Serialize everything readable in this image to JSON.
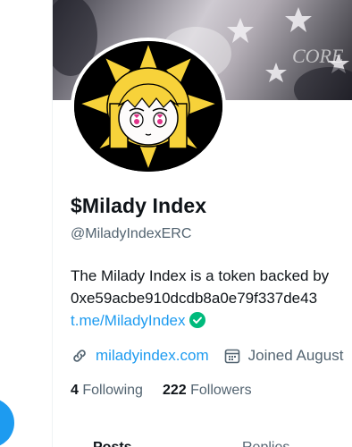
{
  "profile": {
    "display_name": "$Milady Index",
    "handle": "@MiladyIndexERC",
    "bio_line1": "The Milady Index is a token backed by",
    "bio_line2": "0xe59acbe910dcdb8a0e79f337de43",
    "bio_link": "t.me/MiladyIndex",
    "website": "miladyindex.com",
    "joined": "Joined August"
  },
  "stats": {
    "following_count": "4",
    "following_label": "Following",
    "followers_count": "222",
    "followers_label": "Followers"
  },
  "tabs": [
    {
      "label": "Posts"
    },
    {
      "label": "Replies"
    }
  ],
  "colors": {
    "accent": "#1d9bf0",
    "secondary_text": "#536471",
    "verified": "#00ba7c"
  },
  "icons": [
    "link-icon",
    "calendar-icon",
    "verified-check-icon",
    "compose-icon"
  ]
}
